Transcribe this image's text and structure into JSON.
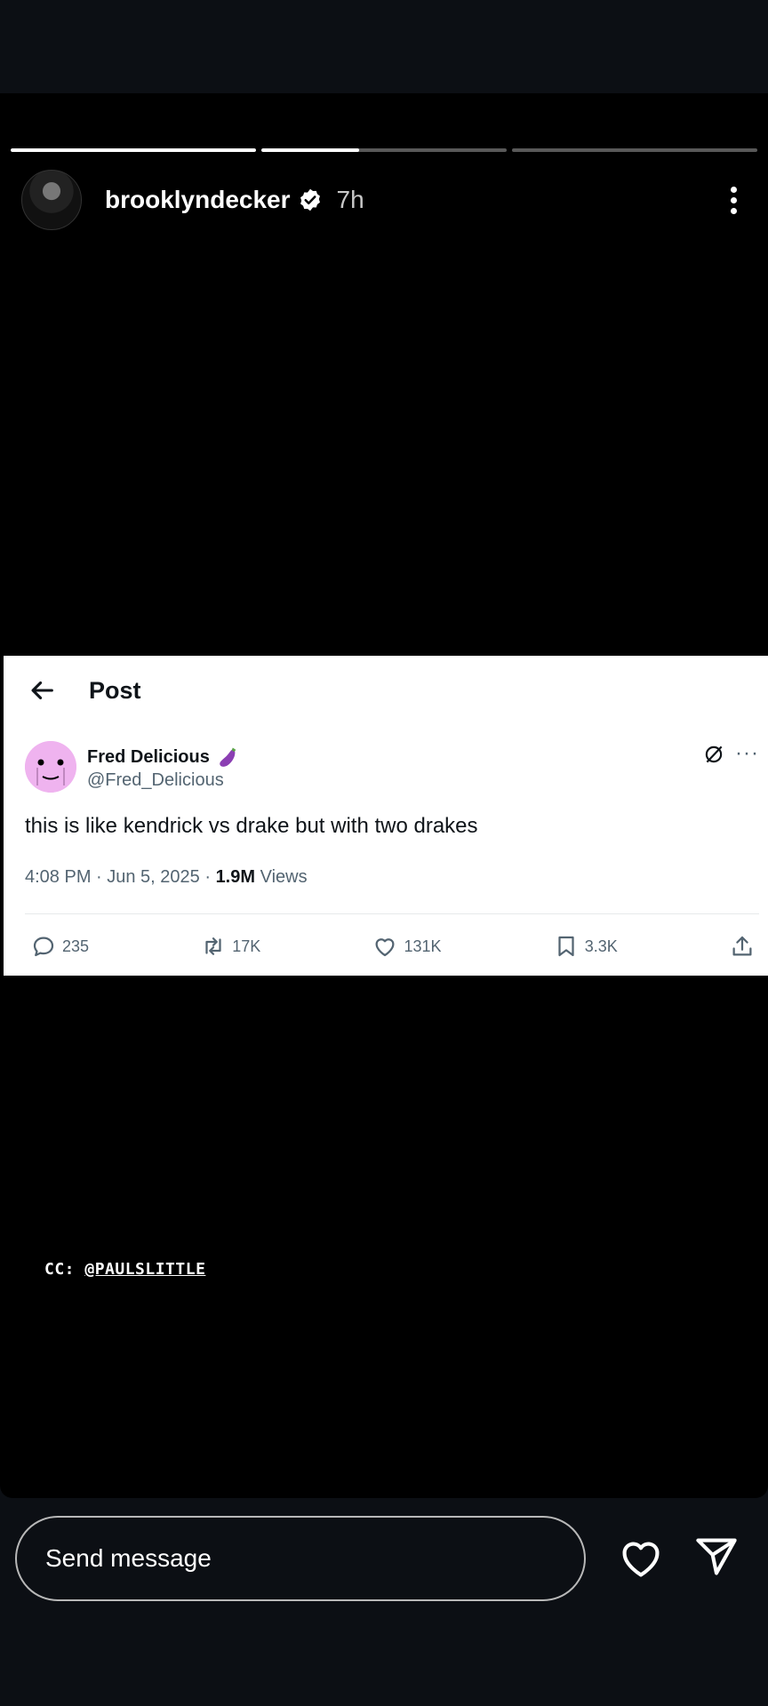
{
  "story": {
    "username": "brooklyndecker",
    "time": "7h",
    "progress": [
      1.0,
      0.4,
      0.0
    ]
  },
  "tweet": {
    "header_title": "Post",
    "author_name": "Fred Delicious",
    "author_handle": "@Fred_Delicious",
    "text": "this is like kendrick vs drake but with two drakes",
    "timestamp": "4:08 PM · Jun 5, 2025 · ",
    "views_count": "1.9M",
    "views_label": " Views",
    "replies": "235",
    "reposts": "17K",
    "likes": "131K",
    "bookmarks": "3.3K"
  },
  "caption": {
    "prefix": "CC: ",
    "mention": "@PAULSLITTLE"
  },
  "footer": {
    "message_placeholder": "Send message"
  },
  "colors": {
    "background": "#0c0f14",
    "story_bg": "#000000",
    "tweet_bg": "#ffffff",
    "tweet_muted": "#536471",
    "avatar_pink": "#efb3ef"
  }
}
